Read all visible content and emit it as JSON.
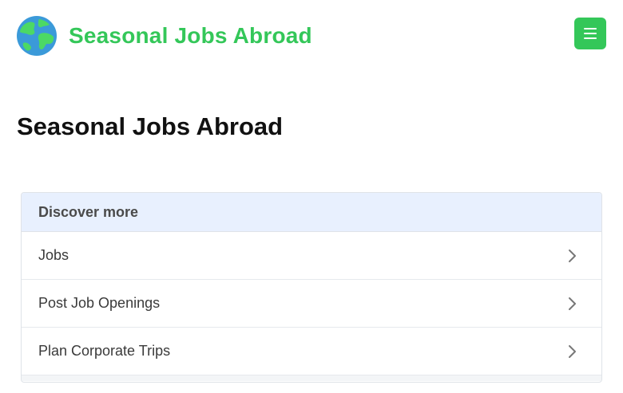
{
  "header": {
    "logo_icon": "globe-icon",
    "site_title": "Seasonal Jobs Abroad",
    "menu_icon": "hamburger-menu-icon",
    "accent_color": "#34c759"
  },
  "main": {
    "page_title": "Seasonal Jobs Abroad"
  },
  "discover": {
    "heading": "Discover more",
    "header_bg": "#e8f0fe",
    "items": [
      {
        "label": "Jobs",
        "icon": "chevron-right-icon"
      },
      {
        "label": "Post Job Openings",
        "icon": "chevron-right-icon"
      },
      {
        "label": "Plan Corporate Trips",
        "icon": "chevron-right-icon"
      }
    ]
  }
}
